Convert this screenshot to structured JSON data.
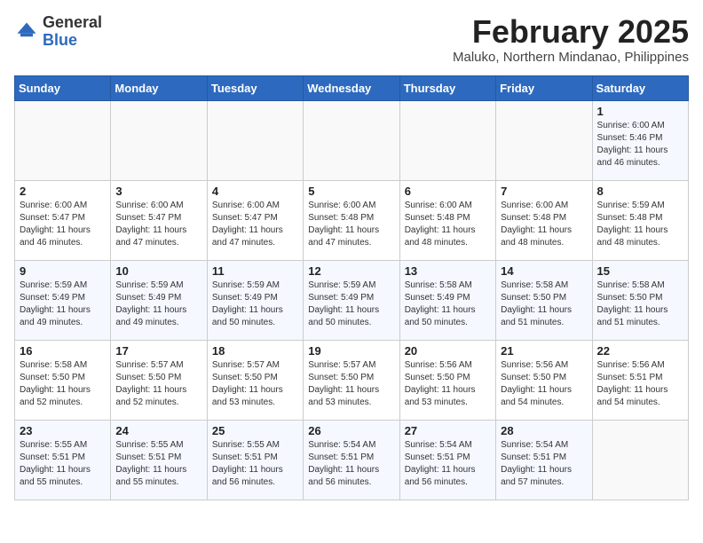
{
  "header": {
    "logo_general": "General",
    "logo_blue": "Blue",
    "month_title": "February 2025",
    "subtitle": "Maluko, Northern Mindanao, Philippines"
  },
  "calendar": {
    "columns": [
      "Sunday",
      "Monday",
      "Tuesday",
      "Wednesday",
      "Thursday",
      "Friday",
      "Saturday"
    ],
    "weeks": [
      [
        {
          "day": "",
          "info": ""
        },
        {
          "day": "",
          "info": ""
        },
        {
          "day": "",
          "info": ""
        },
        {
          "day": "",
          "info": ""
        },
        {
          "day": "",
          "info": ""
        },
        {
          "day": "",
          "info": ""
        },
        {
          "day": "1",
          "info": "Sunrise: 6:00 AM\nSunset: 5:46 PM\nDaylight: 11 hours\nand 46 minutes."
        }
      ],
      [
        {
          "day": "2",
          "info": "Sunrise: 6:00 AM\nSunset: 5:47 PM\nDaylight: 11 hours\nand 46 minutes."
        },
        {
          "day": "3",
          "info": "Sunrise: 6:00 AM\nSunset: 5:47 PM\nDaylight: 11 hours\nand 47 minutes."
        },
        {
          "day": "4",
          "info": "Sunrise: 6:00 AM\nSunset: 5:47 PM\nDaylight: 11 hours\nand 47 minutes."
        },
        {
          "day": "5",
          "info": "Sunrise: 6:00 AM\nSunset: 5:48 PM\nDaylight: 11 hours\nand 47 minutes."
        },
        {
          "day": "6",
          "info": "Sunrise: 6:00 AM\nSunset: 5:48 PM\nDaylight: 11 hours\nand 48 minutes."
        },
        {
          "day": "7",
          "info": "Sunrise: 6:00 AM\nSunset: 5:48 PM\nDaylight: 11 hours\nand 48 minutes."
        },
        {
          "day": "8",
          "info": "Sunrise: 5:59 AM\nSunset: 5:48 PM\nDaylight: 11 hours\nand 48 minutes."
        }
      ],
      [
        {
          "day": "9",
          "info": "Sunrise: 5:59 AM\nSunset: 5:49 PM\nDaylight: 11 hours\nand 49 minutes."
        },
        {
          "day": "10",
          "info": "Sunrise: 5:59 AM\nSunset: 5:49 PM\nDaylight: 11 hours\nand 49 minutes."
        },
        {
          "day": "11",
          "info": "Sunrise: 5:59 AM\nSunset: 5:49 PM\nDaylight: 11 hours\nand 50 minutes."
        },
        {
          "day": "12",
          "info": "Sunrise: 5:59 AM\nSunset: 5:49 PM\nDaylight: 11 hours\nand 50 minutes."
        },
        {
          "day": "13",
          "info": "Sunrise: 5:58 AM\nSunset: 5:49 PM\nDaylight: 11 hours\nand 50 minutes."
        },
        {
          "day": "14",
          "info": "Sunrise: 5:58 AM\nSunset: 5:50 PM\nDaylight: 11 hours\nand 51 minutes."
        },
        {
          "day": "15",
          "info": "Sunrise: 5:58 AM\nSunset: 5:50 PM\nDaylight: 11 hours\nand 51 minutes."
        }
      ],
      [
        {
          "day": "16",
          "info": "Sunrise: 5:58 AM\nSunset: 5:50 PM\nDaylight: 11 hours\nand 52 minutes."
        },
        {
          "day": "17",
          "info": "Sunrise: 5:57 AM\nSunset: 5:50 PM\nDaylight: 11 hours\nand 52 minutes."
        },
        {
          "day": "18",
          "info": "Sunrise: 5:57 AM\nSunset: 5:50 PM\nDaylight: 11 hours\nand 53 minutes."
        },
        {
          "day": "19",
          "info": "Sunrise: 5:57 AM\nSunset: 5:50 PM\nDaylight: 11 hours\nand 53 minutes."
        },
        {
          "day": "20",
          "info": "Sunrise: 5:56 AM\nSunset: 5:50 PM\nDaylight: 11 hours\nand 53 minutes."
        },
        {
          "day": "21",
          "info": "Sunrise: 5:56 AM\nSunset: 5:50 PM\nDaylight: 11 hours\nand 54 minutes."
        },
        {
          "day": "22",
          "info": "Sunrise: 5:56 AM\nSunset: 5:51 PM\nDaylight: 11 hours\nand 54 minutes."
        }
      ],
      [
        {
          "day": "23",
          "info": "Sunrise: 5:55 AM\nSunset: 5:51 PM\nDaylight: 11 hours\nand 55 minutes."
        },
        {
          "day": "24",
          "info": "Sunrise: 5:55 AM\nSunset: 5:51 PM\nDaylight: 11 hours\nand 55 minutes."
        },
        {
          "day": "25",
          "info": "Sunrise: 5:55 AM\nSunset: 5:51 PM\nDaylight: 11 hours\nand 56 minutes."
        },
        {
          "day": "26",
          "info": "Sunrise: 5:54 AM\nSunset: 5:51 PM\nDaylight: 11 hours\nand 56 minutes."
        },
        {
          "day": "27",
          "info": "Sunrise: 5:54 AM\nSunset: 5:51 PM\nDaylight: 11 hours\nand 56 minutes."
        },
        {
          "day": "28",
          "info": "Sunrise: 5:54 AM\nSunset: 5:51 PM\nDaylight: 11 hours\nand 57 minutes."
        },
        {
          "day": "",
          "info": ""
        }
      ]
    ]
  }
}
